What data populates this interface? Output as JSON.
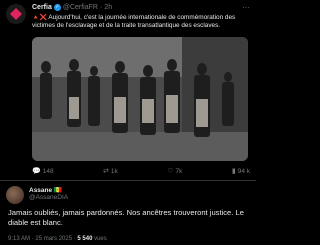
{
  "post": {
    "author_name": "Cerfia",
    "author_handle": "@CerfiaFR",
    "separator": "·",
    "time": "2h",
    "more_label": "···",
    "emoji": "🔺❌",
    "text": "Aujourd'hui, c'est la journée internationale de commémoration des victimes de l'esclavage et de la traite transatlantique des esclaves.",
    "actions": {
      "replies": "148",
      "reposts": "1k",
      "likes": "7k",
      "views": "94 k"
    }
  },
  "reply": {
    "author_name": "Assane 🇸🇳",
    "author_handle": "@AssaneDIA",
    "text": "Jamais oubliés, jamais pardonnés. Nos ancêtres trouveront justice. Le diable est blanc.",
    "time": "9:13 AM",
    "date": "25 mars 2025",
    "views_count": "5 540",
    "views_label": "vues",
    "meta_separator": "·"
  },
  "icons": {
    "reply": "speech-bubble",
    "repost": "retweet-arrows",
    "like": "heart",
    "views": "bar-chart"
  }
}
